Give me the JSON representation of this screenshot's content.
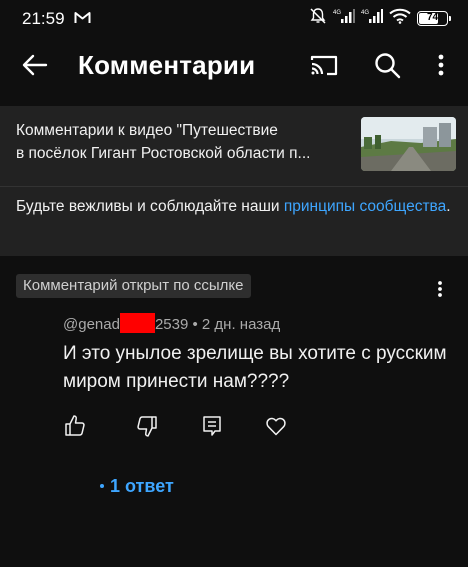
{
  "status_bar": {
    "time": "21:59",
    "battery_level": "74",
    "battery_fraction": 0.74,
    "icons": [
      "gmail-icon",
      "mute-icon",
      "signal-icon",
      "signal-icon",
      "wifi-icon",
      "battery-icon"
    ]
  },
  "app_bar": {
    "title": "Комментарии",
    "icons": [
      "back-arrow-icon",
      "cast-icon",
      "search-icon",
      "more-vert-icon"
    ]
  },
  "header": {
    "video_line1": "Комментарии к видео \"Путешествие",
    "video_line2": "в посёлок Гигант Ростовской области п...",
    "policy_text": "Будьте вежливы и соблюдайте наши ",
    "policy_link": "принципы сообщества",
    "policy_end": "."
  },
  "comment": {
    "chip": "Комментарий открыт по ссылке",
    "author_prefix": "@genad",
    "author_suffix": "2539",
    "separator": " • ",
    "time": "2 дн. назад",
    "text": "И это унылое зрелище вы хотите с русским миром принести нам????",
    "actions": [
      "like-icon",
      "dislike-icon",
      "reply-icon",
      "heart-icon"
    ]
  },
  "replies": {
    "label": "1 ответ"
  },
  "colors": {
    "background": "#0f0f0f",
    "panel": "#222222",
    "link": "#3ea6ff",
    "redaction": "#ff0000",
    "secondary_text": "#aaaaaa"
  }
}
